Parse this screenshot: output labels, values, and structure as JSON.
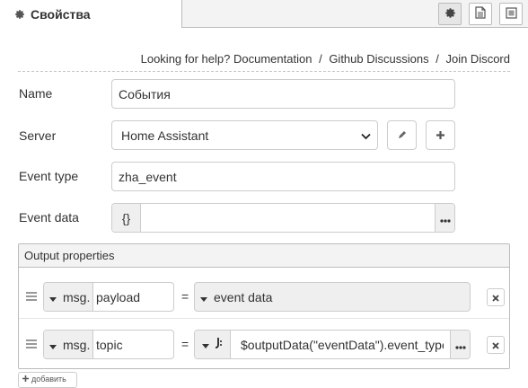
{
  "tab": {
    "title": "Свойства",
    "icon": "gear-icon"
  },
  "toolbar": {
    "buttons": [
      {
        "icon": "gear-icon",
        "active": true
      },
      {
        "icon": "document-icon",
        "active": false
      },
      {
        "icon": "frame-icon",
        "active": false
      }
    ]
  },
  "help": {
    "prefix": "Looking for help?",
    "links": [
      "Documentation",
      "Github Discussions",
      "Join Discord"
    ],
    "separator": "/"
  },
  "form": {
    "name": {
      "label": "Name",
      "value": "События"
    },
    "server": {
      "label": "Server",
      "value": "Home Assistant"
    },
    "event_type": {
      "label": "Event type",
      "value": "zha_event"
    },
    "event_data": {
      "label": "Event data",
      "type_symbol": "{}",
      "value": ""
    }
  },
  "output": {
    "title": "Output properties",
    "rows": [
      {
        "prefix": "msg.",
        "property": "payload",
        "equals": "=",
        "value": "event data"
      },
      {
        "prefix": "msg.",
        "property": "topic",
        "equals": "=",
        "value": "$outputData(\"eventData\").event_type"
      }
    ],
    "add_label": "добавить"
  },
  "colors": {
    "accent": "#333333",
    "border": "#cccccc",
    "header_bg": "#f3f3f3"
  }
}
